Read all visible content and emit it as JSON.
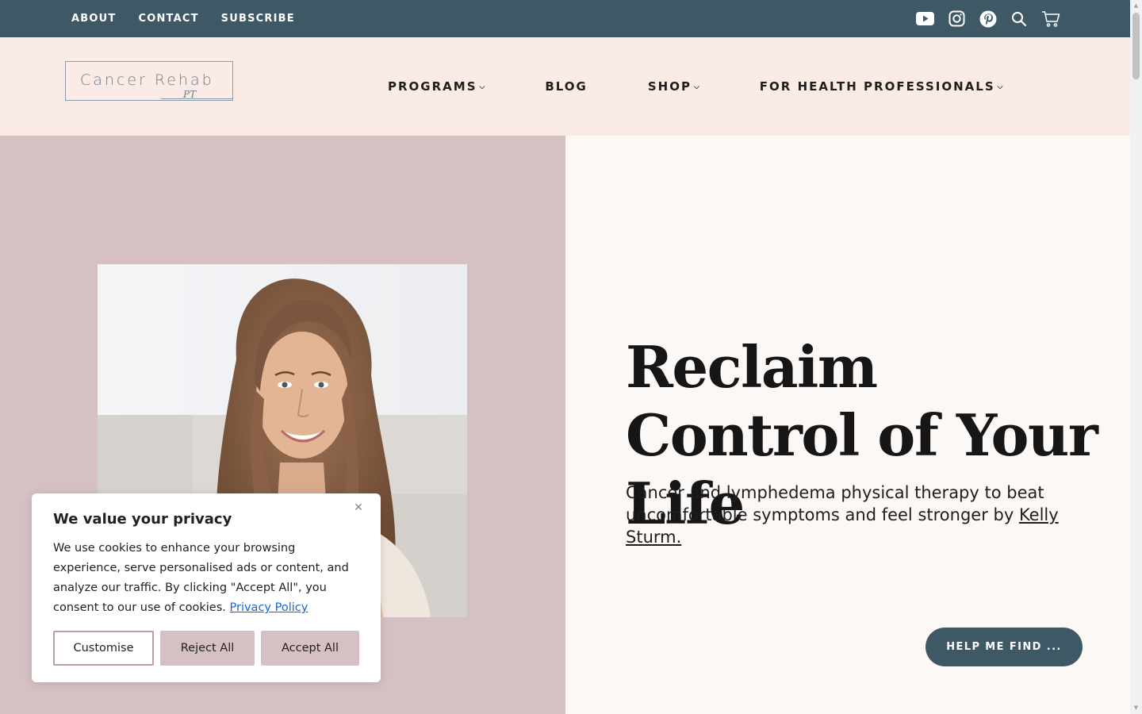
{
  "topbar": {
    "links": [
      "ABOUT",
      "CONTACT",
      "SUBSCRIBE"
    ],
    "icons": [
      "youtube-icon",
      "instagram-icon",
      "pinterest-icon",
      "search-icon",
      "cart-icon"
    ]
  },
  "header": {
    "logo": {
      "text": "Cancer Rehab",
      "sub": "PT"
    },
    "nav": [
      {
        "label": "PROGRAMS",
        "has_dropdown": true
      },
      {
        "label": "BLOG",
        "has_dropdown": false
      },
      {
        "label": "SHOP",
        "has_dropdown": true
      },
      {
        "label": "FOR HEALTH PROFESSIONALS",
        "has_dropdown": true
      }
    ],
    "chevron": "⌵"
  },
  "hero": {
    "headline": "Reclaim Control of Your Life",
    "subhead_prefix": "Cancer and lymphedema physical therapy to beat uncomfortable symptoms and feel stronger by ",
    "subhead_link": "Kelly Sturm.",
    "cta": "HELP ME FIND ..."
  },
  "cookie": {
    "title": "We value your privacy",
    "body": "We use cookies to enhance your browsing experience, serve personalised ads or content, and analyze our traffic. By clicking \"Accept All\", you consent to our use of cookies.",
    "policy_link": "Privacy Policy",
    "close_glyph": "✕",
    "buttons": {
      "customise": "Customise",
      "reject": "Reject All",
      "accept": "Accept All"
    }
  },
  "colors": {
    "topbar": "#3f5866",
    "header": "#fbebe6",
    "hero_left": "#d5c1c4",
    "hero_right": "#fcf8f6",
    "cta": "#3f5866",
    "policy_link": "#1863dc"
  }
}
